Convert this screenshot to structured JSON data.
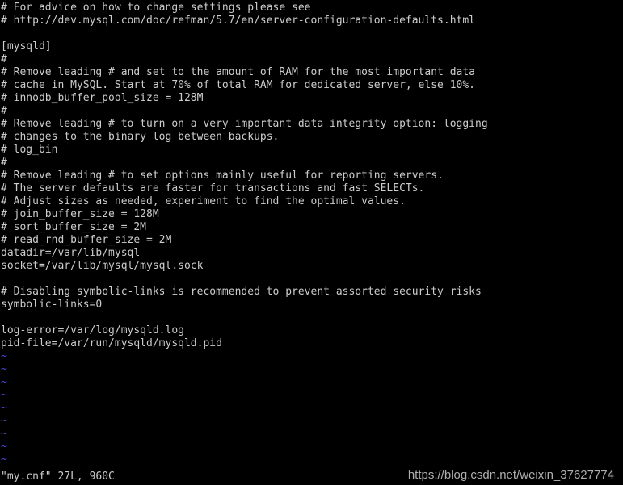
{
  "terminal": {
    "background_color": "#000000",
    "foreground_color": "#cccccc",
    "tilde_color": "#4b4bd8",
    "columns": 95,
    "rows": 37
  },
  "editor": {
    "name": "vim",
    "filename": "my.cnf",
    "buffer_lines": [
      "# For advice on how to change settings please see",
      "# http://dev.mysql.com/doc/refman/5.7/en/server-configuration-defaults.html",
      "",
      "[mysqld]",
      "#",
      "# Remove leading # and set to the amount of RAM for the most important data",
      "# cache in MySQL. Start at 70% of total RAM for dedicated server, else 10%.",
      "# innodb_buffer_pool_size = 128M",
      "#",
      "# Remove leading # to turn on a very important data integrity option: logging",
      "# changes to the binary log between backups.",
      "# log_bin",
      "#",
      "# Remove leading # to set options mainly useful for reporting servers.",
      "# The server defaults are faster for transactions and fast SELECTs.",
      "# Adjust sizes as needed, experiment to find the optimal values.",
      "# join_buffer_size = 128M",
      "# sort_buffer_size = 2M",
      "# read_rnd_buffer_size = 2M",
      "datadir=/var/lib/mysql",
      "socket=/var/lib/mysql/mysql.sock",
      "",
      "# Disabling symbolic-links is recommended to prevent assorted security risks",
      "symbolic-links=0",
      "",
      "log-error=/var/log/mysqld.log",
      "pid-file=/var/run/mysqld/mysqld.pid"
    ],
    "filler_char": "~",
    "filler_count": 9,
    "status_line": "\"my.cnf\" 27L, 960C"
  },
  "watermark": {
    "text": "https://blog.csdn.net/weixin_37627774"
  }
}
